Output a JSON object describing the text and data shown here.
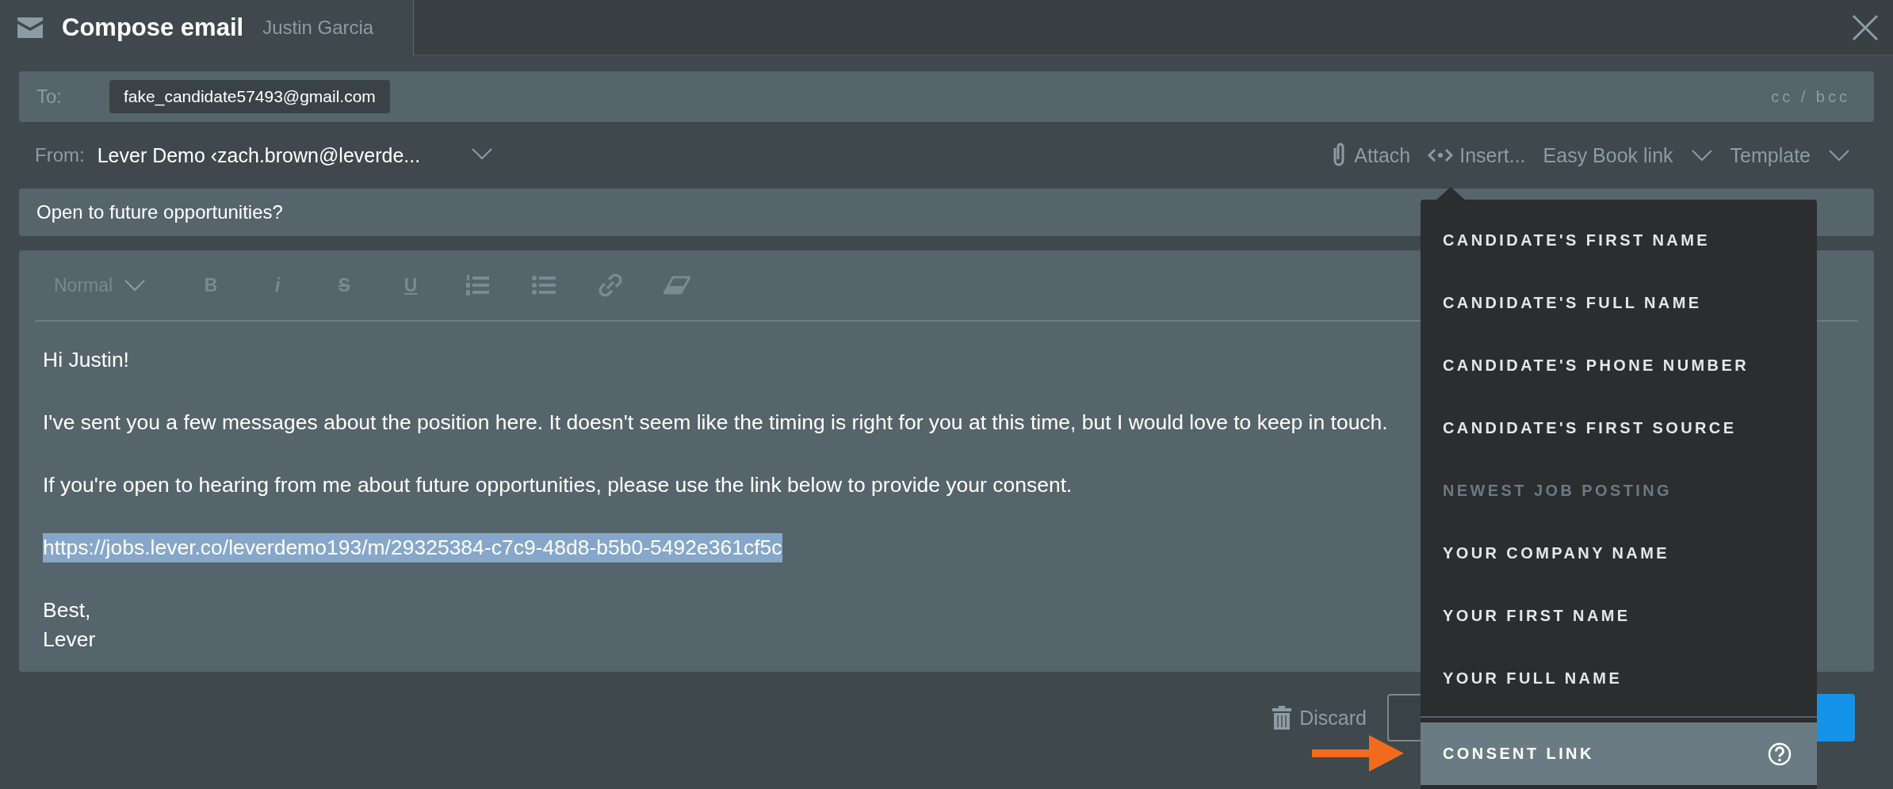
{
  "window": {
    "title": "Compose email",
    "subtitle": "Justin Garcia"
  },
  "to": {
    "label": "To:",
    "recipients": [
      "fake_candidate57493@gmail.com"
    ],
    "cc_bcc": "cc / bcc"
  },
  "from": {
    "label": "From:",
    "value": "Lever Demo ‹zach.brown@leverde..."
  },
  "actions": [
    {
      "kind": "attach",
      "label": "Attach"
    },
    {
      "kind": "insert",
      "label": "Insert..."
    },
    {
      "kind": "dropdown",
      "label": "Easy Book link"
    },
    {
      "kind": "dropdown",
      "label": "Template"
    }
  ],
  "subject": "Open to future opportunities?",
  "editor": {
    "toolbar": [
      {
        "kind": "style",
        "label": "Normal"
      },
      {
        "kind": "bold",
        "glyph": "B"
      },
      {
        "kind": "italic",
        "glyph": "i"
      },
      {
        "kind": "strike",
        "glyph": "S"
      },
      {
        "kind": "underline",
        "glyph": "U"
      },
      {
        "kind": "ordered-list"
      },
      {
        "kind": "bullet-list"
      },
      {
        "kind": "link"
      },
      {
        "kind": "eraser"
      }
    ],
    "paragraphs": [
      {
        "lines": [
          "Hi Justin!"
        ],
        "highlighted": false
      },
      {
        "lines": [
          "I've sent you a few messages about the  position here. It doesn't seem like the timing is right for you at this time, but I would love to keep in touch."
        ],
        "highlighted": false
      },
      {
        "lines": [
          "If you're open to hearing from me about future opportunities, please use the link below to provide your consent."
        ],
        "highlighted": false
      },
      {
        "lines": [
          "https://jobs.lever.co/leverdemo193/m/29325384-c7c9-48d8-b5b0-5492e361cf5c"
        ],
        "highlighted": true
      },
      {
        "lines": [
          "Best,",
          "Lever"
        ],
        "highlighted": false
      }
    ]
  },
  "footer": {
    "discard": "Discard"
  },
  "insert_menu": {
    "items": [
      {
        "label": "CANDIDATE'S FIRST NAME",
        "disabled": false,
        "selected": false
      },
      {
        "label": "CANDIDATE'S FULL NAME",
        "disabled": false,
        "selected": false
      },
      {
        "label": "CANDIDATE'S PHONE NUMBER",
        "disabled": false,
        "selected": false
      },
      {
        "label": "CANDIDATE'S FIRST SOURCE",
        "disabled": false,
        "selected": false
      },
      {
        "label": "NEWEST JOB POSTING",
        "disabled": true,
        "selected": false
      },
      {
        "label": "YOUR COMPANY NAME",
        "disabled": false,
        "selected": false
      },
      {
        "label": "YOUR FIRST NAME",
        "disabled": false,
        "selected": false
      },
      {
        "label": "YOUR FULL NAME",
        "disabled": false,
        "selected": false
      }
    ],
    "special": {
      "label": "CONSENT LINK",
      "selected": true
    }
  }
}
